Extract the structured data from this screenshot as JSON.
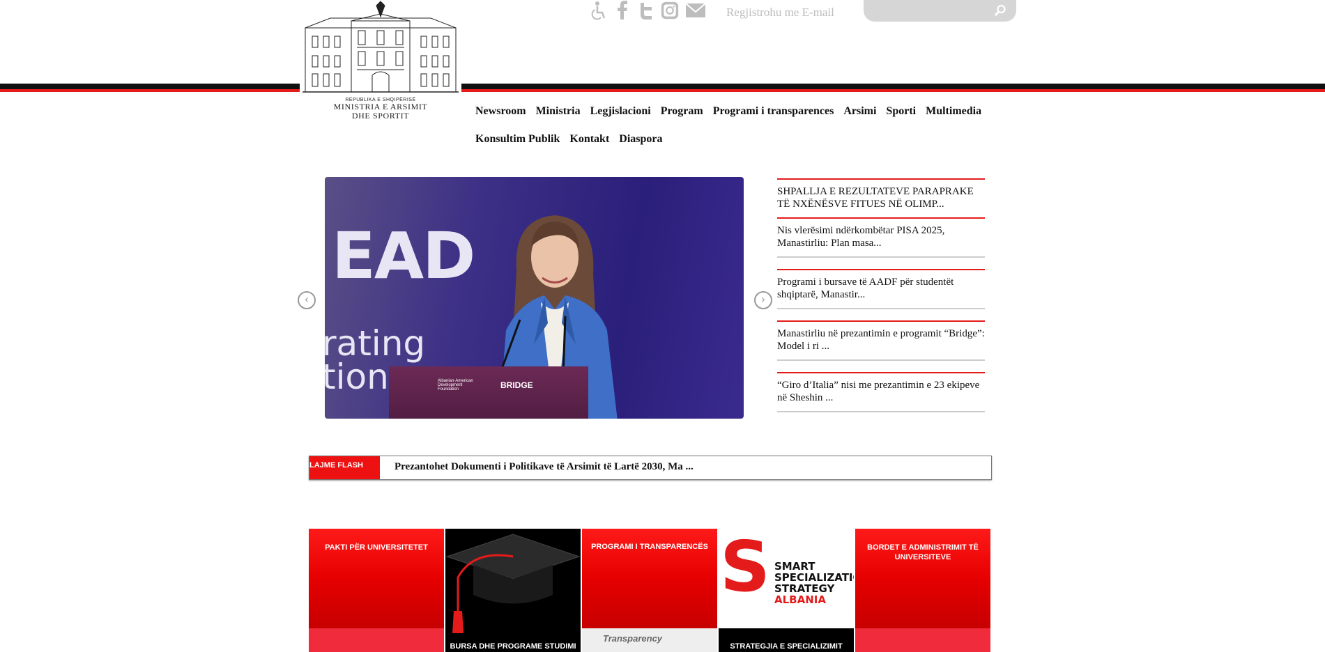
{
  "header": {
    "republic": "REPUBLIKA E SHQIPËRISË",
    "ministry_line1": "MINISTRIA E ARSIMIT",
    "ministry_line2": "DHE SPORTIT",
    "register_label": "Regjistrohu me E-mail",
    "search_placeholder": ""
  },
  "nav": {
    "row1": [
      "Newsroom",
      "Ministria",
      "Legjislacioni",
      "Program",
      "Programi i transparences",
      "Arsimi",
      "Sporti",
      "Multimedia"
    ],
    "row2": [
      "Konsultim Publik",
      "Kontakt",
      "Diaspora"
    ]
  },
  "slider": {
    "big_text": "EAD",
    "sub_text1": "rating",
    "sub_text2": "tion",
    "podium_label": "BRIDGE",
    "podium_small": "Albanian-American Development Foundation"
  },
  "news": [
    "SHPALLJA E REZULTATEVE PARAPRAKE TË NXËNËSVE FITUES NË OLIMP...",
    "Nis vlerësimi ndërkombëtar PISA 2025, Manastirliu: Plan masa...",
    "Programi i bursave të AADF për studentët shqiptarë, Manastir...",
    "Manastirliu në prezantimin e programit “Bridge”: Model i ri ...",
    "“Giro d’Italia” nisi me prezantimin e 23 ekipeve në Sheshin ..."
  ],
  "flash": {
    "tag": "LAJME FLASH",
    "text": "Prezantohet Dokumenti i Politikave të Arsimit të Lartë 2030, Ma ..."
  },
  "tiles": {
    "t1": "PAKTI PËR UNIVERSITETET",
    "t2": "BURSA DHE PROGRAME STUDIMI",
    "t3": "PROGRAMI I TRANSPARENCËS",
    "t3_bar": "Transparency",
    "t4_words": [
      "SMART",
      "SPECIALIZATION",
      "STRATEGY",
      "ALBANIA"
    ],
    "t4_bar": "STRATEGJIA E SPECIALIZIMIT",
    "t5": "BORDET E ADMINISTRIMIT TË UNIVERSITEVE"
  },
  "colors": {
    "red": "#e41b1b",
    "black": "#111111",
    "grey": "#bdbdbd"
  },
  "icons": [
    "accessibility-icon",
    "facebook-icon",
    "twitter-icon",
    "instagram-icon",
    "mail-icon",
    "search-icon",
    "prev-arrow-icon",
    "next-arrow-icon"
  ]
}
